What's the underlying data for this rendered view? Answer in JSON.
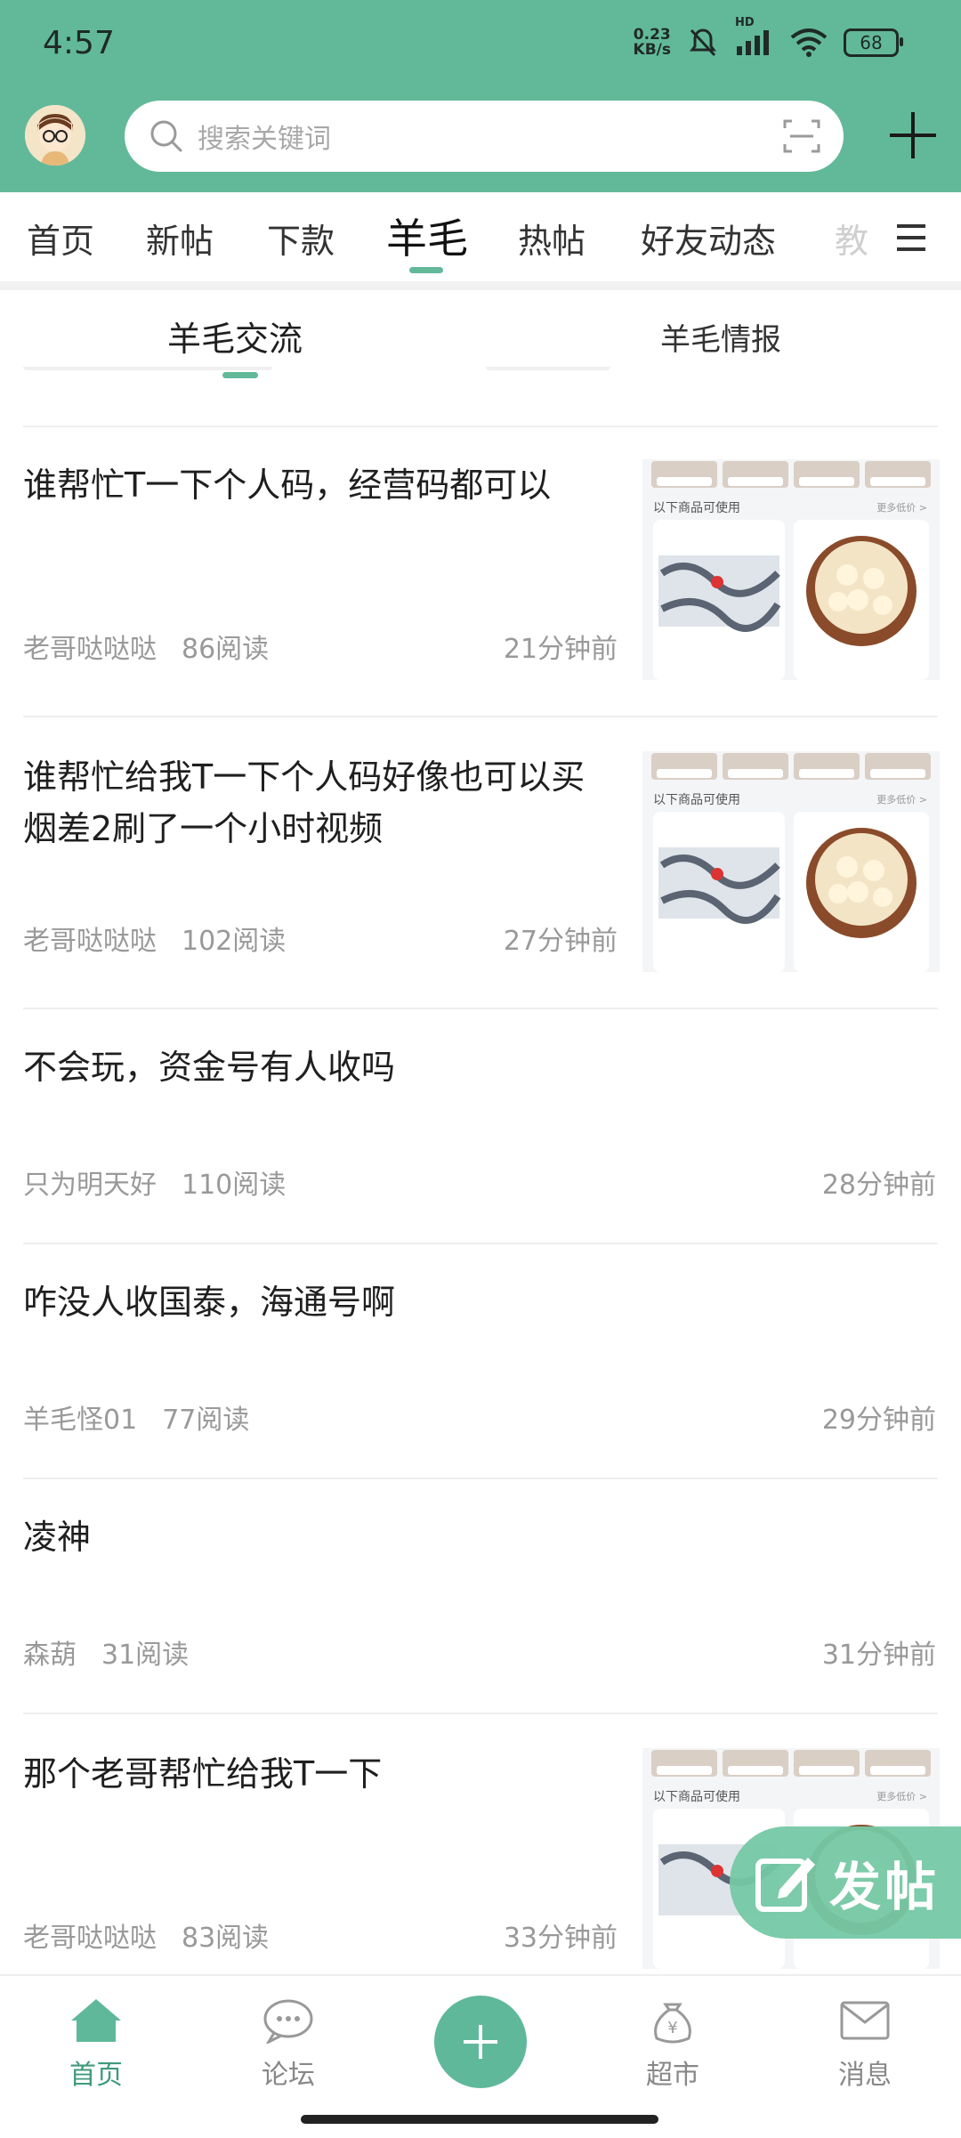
{
  "status_bar": {
    "time": "4:57",
    "net_speed_value": "0.23",
    "net_speed_unit": "KB/s",
    "hd_label": "HD",
    "battery": "68"
  },
  "header": {
    "search_placeholder": "搜索关键词"
  },
  "channel_tabs": [
    {
      "label": "首页"
    },
    {
      "label": "新帖"
    },
    {
      "label": "下款"
    },
    {
      "label": "羊毛"
    },
    {
      "label": "热帖"
    },
    {
      "label": "好友动态"
    },
    {
      "label": "教"
    }
  ],
  "active_channel": "羊毛",
  "sub_tabs": [
    {
      "label": "羊毛交流"
    },
    {
      "label": "羊毛情报"
    }
  ],
  "thumb_text": {
    "strip_labels": [
      "实体商场",
      "超市",
      "公交地铁",
      "餐厅"
    ],
    "section_label": "以下商品可使用",
    "more_label": "更多低价 >"
  },
  "posts": [
    {
      "title": "谁帮忙T一下个人码，经营码都可以",
      "author": "老哥哒哒哒",
      "reads": "86阅读",
      "time": "21分钟前",
      "has_image": true
    },
    {
      "title": "谁帮忙给我T一下个人码好像也可以买烟差2刷了一个小时视频",
      "author": "老哥哒哒哒",
      "reads": "102阅读",
      "time": "27分钟前",
      "has_image": true
    },
    {
      "title": "不会玩，资金号有人收吗",
      "author": "只为明天好",
      "reads": "110阅读",
      "time": "28分钟前",
      "has_image": false
    },
    {
      "title": "咋没人收国泰，海通号啊",
      "author": "羊毛怪01",
      "reads": "77阅读",
      "time": "29分钟前",
      "has_image": false
    },
    {
      "title": "凌神",
      "author": "森葫",
      "reads": "31阅读",
      "time": "31分钟前",
      "has_image": false
    },
    {
      "title": "那个老哥帮忙给我T一下",
      "author": "老哥哒哒哒",
      "reads": "83阅读",
      "time": "33分钟前",
      "has_image": true
    }
  ],
  "fab": {
    "label": "发帖"
  },
  "bottom_nav": [
    {
      "label": "首页",
      "icon": "home-icon"
    },
    {
      "label": "论坛",
      "icon": "chat-icon"
    },
    {
      "label": "",
      "icon": "plus-icon"
    },
    {
      "label": "超市",
      "icon": "money-bag-icon"
    },
    {
      "label": "消息",
      "icon": "mail-icon"
    }
  ],
  "colors": {
    "accent": "#62b99a",
    "accent_dark": "#3f9a7d",
    "fab_bg": "#75c8a5"
  }
}
